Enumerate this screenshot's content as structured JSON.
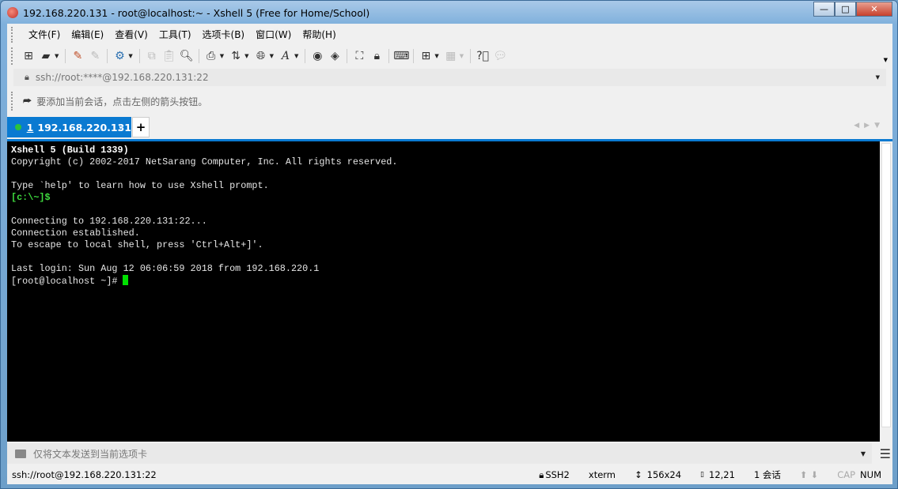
{
  "window": {
    "title": "192.168.220.131 - root@localhost:~ - Xshell 5 (Free for Home/School)"
  },
  "menu": [
    "文件(F)",
    "编辑(E)",
    "查看(V)",
    "工具(T)",
    "选项卡(B)",
    "窗口(W)",
    "帮助(H)"
  ],
  "address": {
    "value": "ssh://root:****@192.168.220.131:22"
  },
  "hint": "要添加当前会话，点击左侧的箭头按钮。",
  "tab": {
    "number": "1",
    "label": "192.168.220.131",
    "close": "×",
    "new": "+",
    "status_color": "#2bc33b"
  },
  "terminal": {
    "lines": [
      {
        "text": "Xshell 5 (Build 1339)",
        "style": "b"
      },
      {
        "text": "Copyright (c) 2002-2017 NetSarang Computer, Inc. All rights reserved.",
        "style": ""
      },
      {
        "text": "",
        "style": ""
      },
      {
        "text": "Type `help' to learn how to use Xshell prompt.",
        "style": ""
      },
      {
        "text": "[c:\\~]$",
        "style": "g"
      },
      {
        "text": "",
        "style": ""
      },
      {
        "text": "Connecting to 192.168.220.131:22...",
        "style": ""
      },
      {
        "text": "Connection established.",
        "style": ""
      },
      {
        "text": "To escape to local shell, press 'Ctrl+Alt+]'.",
        "style": ""
      },
      {
        "text": "",
        "style": ""
      },
      {
        "text": "Last login: Sun Aug 12 06:06:59 2018 from 192.168.220.1",
        "style": ""
      }
    ],
    "prompt": "[root@localhost ~]#"
  },
  "sendbar": {
    "placeholder": "仅将文本发送到当前选项卡"
  },
  "status": {
    "connection": "ssh://root@192.168.220.131:22",
    "protocol": "SSH2",
    "term": "xterm",
    "size": "156x24",
    "cursor": "12,21",
    "sessions": "1 会话",
    "cap": "CAP",
    "num": "NUM"
  }
}
